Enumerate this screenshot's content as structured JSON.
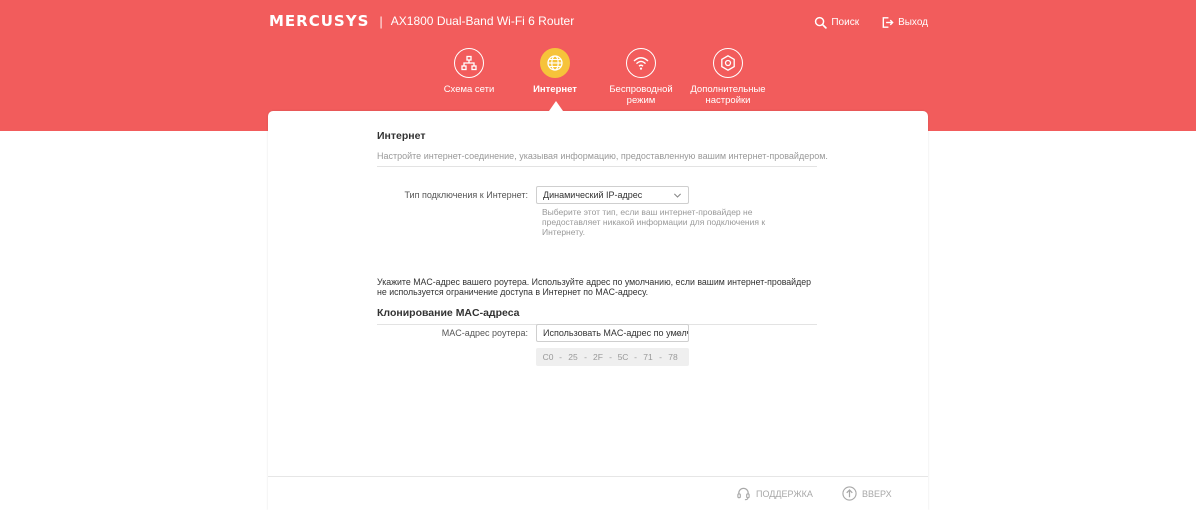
{
  "header": {
    "logo_text": "MERCUSYS",
    "separator": "|",
    "model": "AX1800 Dual-Band Wi-Fi 6 Router",
    "search_label": "Поиск",
    "logout_label": "Выход"
  },
  "nav": {
    "items": [
      {
        "label": "Схема сети",
        "icon": "network-map-icon"
      },
      {
        "label": "Интернет",
        "icon": "globe-icon"
      },
      {
        "label": "Беспроводной режим",
        "icon": "wifi-icon"
      },
      {
        "label": "Дополнительные настройки",
        "icon": "gear-icon"
      }
    ],
    "active_index": 1
  },
  "internet": {
    "title": "Интернет",
    "description": "Настройте интернет-соединение, указывая информацию, предоставленную вашим интернет-провайдером.",
    "connection_type_label": "Тип подключения к Интернет:",
    "connection_type_value": "Динамический IP-адрес",
    "connection_type_hint": "Выберите этот тип, если ваш интернет-провайдер не предоставляет никакой информации для подключения к Интернету."
  },
  "mac": {
    "note": "Укажите MAC-адрес вашего роутера. Используйте адрес по умолчанию, если вашим интернет-провайдер не используется ограничение доступа в Интернет по MAC-адресу.",
    "title": "Клонирование MAC-адреса",
    "label": "MAC-адрес роутера:",
    "select_value": "Использовать MAC-адрес по умолчанию",
    "octets": [
      "C0",
      "25",
      "2F",
      "5C",
      "71",
      "78"
    ],
    "separator": "-"
  },
  "footer": {
    "support_label": "ПОДДЕРЖКА",
    "top_label": "ВВЕРХ"
  },
  "colors": {
    "brand": "#f25c5c",
    "active_nav": "#f6c33a"
  }
}
